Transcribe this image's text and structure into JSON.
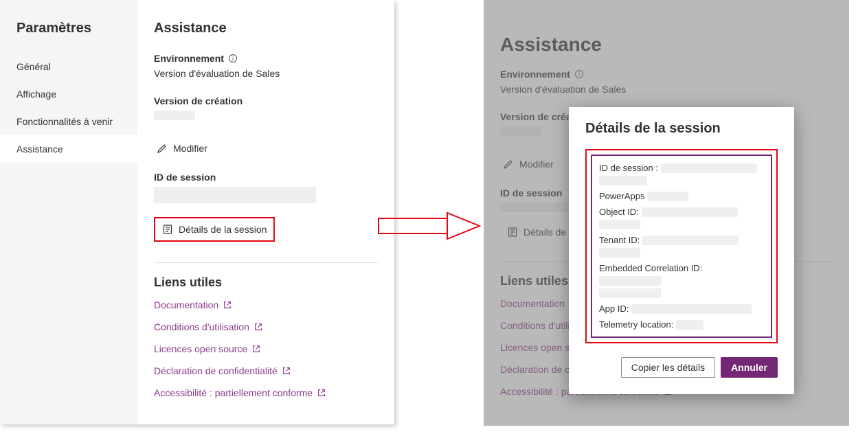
{
  "sidebar": {
    "title": "Paramètres",
    "items": [
      {
        "label": "Général"
      },
      {
        "label": "Affichage"
      },
      {
        "label": "Fonctionnalités à venir"
      },
      {
        "label": "Assistance"
      }
    ]
  },
  "assistance": {
    "title": "Assistance",
    "env_label": "Environnement",
    "env_value": "Version d'évaluation de Sales",
    "version_label": "Version de création",
    "modify_label": "Modifier",
    "session_id_label": "ID de session",
    "session_details_btn": "Détails de la session"
  },
  "links": {
    "title": "Liens utiles",
    "items": [
      "Documentation",
      "Conditions d'utilisation",
      "Licences open source",
      "Déclaration de confidentialité",
      "Accessibilité : partiellement conforme"
    ]
  },
  "modal": {
    "title": "Détails de la session",
    "rows": [
      "ID de session :",
      "PowerApps",
      "Object ID:",
      "Tenant ID:",
      "Embedded Correlation ID:",
      "App ID:",
      "Telemetry location:"
    ],
    "copy_btn": "Copier les détails",
    "cancel_btn": "Annuler"
  }
}
